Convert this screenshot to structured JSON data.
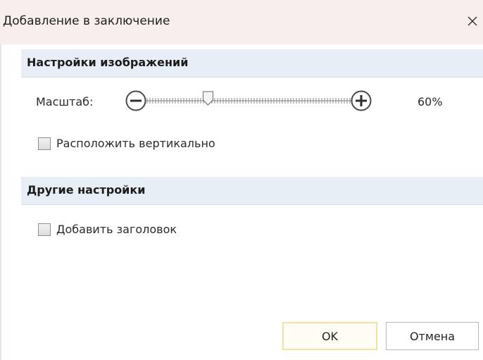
{
  "window": {
    "title": "Добавление в заключение",
    "close_icon": "close-icon"
  },
  "image_settings": {
    "header": "Настройки изображений",
    "scale_label": "Масштаб:",
    "scale_value_text": "60%",
    "scale_fraction": 0.3,
    "vertical_checkbox": {
      "label": "Расположить вертикально",
      "checked": false
    }
  },
  "other_settings": {
    "header": "Другие настройки",
    "add_title_checkbox": {
      "label": "Добавить заголовок",
      "checked": false
    }
  },
  "buttons": {
    "ok": "OK",
    "cancel": "Отмена"
  },
  "colors": {
    "title_bar": "#f8efec",
    "section_header": "#e7eef6",
    "ok_border": "#f3e2a0"
  }
}
